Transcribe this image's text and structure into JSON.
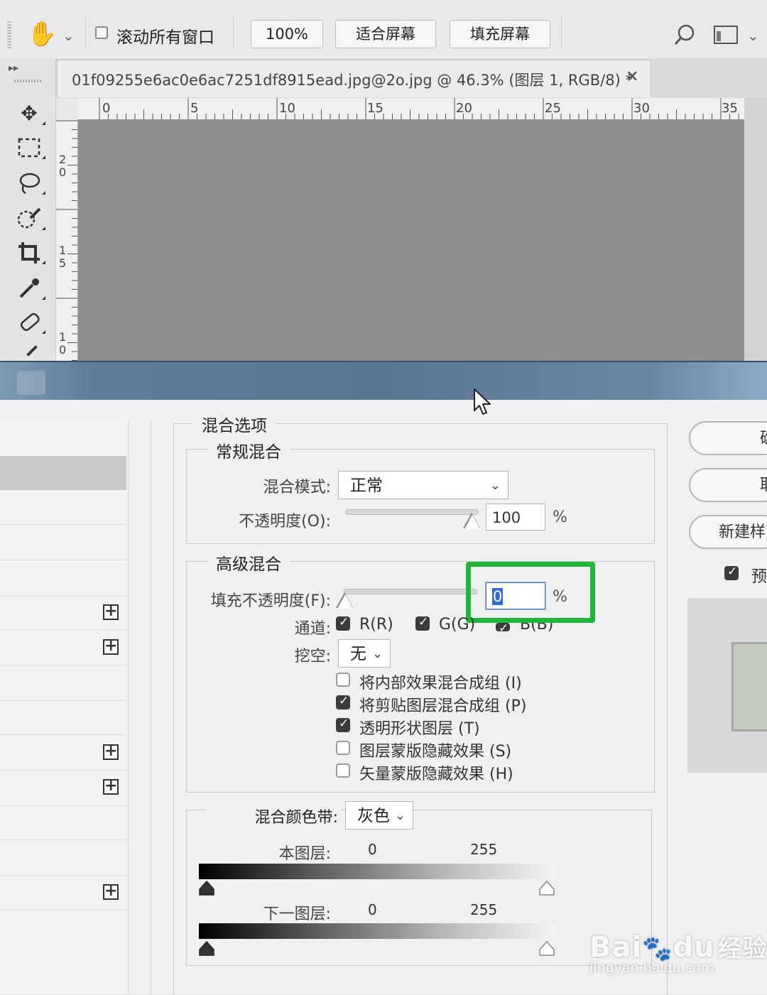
{
  "options_bar": {
    "checkbox_label": "滚动所有窗口",
    "zoom_button": "100%",
    "fit_screen_button": "适合屏幕",
    "fill_screen_button": "填充屏幕",
    "icons": [
      "hand-icon",
      "search-icon",
      "workspace-icon"
    ]
  },
  "document": {
    "tab_title": "01f09255e6ac0e6ac7251df8915ead.jpg@2o.jpg @ 46.3% (图层 1, RGB/8) *",
    "close": "×",
    "ruler_h": [
      "0",
      "5",
      "10",
      "15",
      "20",
      "25",
      "30",
      "35"
    ],
    "ruler_v": [
      "2\n0",
      "1\n5",
      "1\n0"
    ]
  },
  "dialog": {
    "blend_options": {
      "legend": "混合选项",
      "general": {
        "legend": "常规混合",
        "mode_label": "混合模式:",
        "mode_value": "正常",
        "opacity_label": "不透明度(O):",
        "opacity_value": "100",
        "unit": "%"
      },
      "advanced": {
        "legend": "高级混合",
        "fill_label": "填充不透明度(F):",
        "fill_value": "0",
        "unit": "%",
        "channels_label": "通道:",
        "channels": [
          {
            "label": "R(R)",
            "checked": true
          },
          {
            "label": "G(G)",
            "checked": true
          },
          {
            "label": "B(B)",
            "checked": true
          }
        ],
        "knockout_label": "挖空:",
        "knockout_value": "无",
        "options": [
          {
            "label": "将内部效果混合成组 (I)",
            "checked": false
          },
          {
            "label": "将剪贴图层混合成组 (P)",
            "checked": true
          },
          {
            "label": "透明形状图层 (T)",
            "checked": true
          },
          {
            "label": "图层蒙版隐藏效果 (S)",
            "checked": false
          },
          {
            "label": "矢量蒙版隐藏效果 (H)",
            "checked": false
          }
        ]
      },
      "blend_if": {
        "label": "混合颜色带:",
        "value": "灰色",
        "this_layer_label": "本图层:",
        "underlying_label": "下一图层:",
        "min": "0",
        "max": "255"
      }
    },
    "right_buttons": [
      "确",
      "取",
      "新建样"
    ],
    "preview_label": "预"
  },
  "watermark": {
    "brand_a": "Bai",
    "brand_b": "du",
    "brand_c": "经验",
    "url": "jingyan.baidu.com"
  },
  "colors": {
    "highlight": "#1fb43a",
    "titlebar": "#5a7693",
    "canvas": "#8e8e8e"
  }
}
